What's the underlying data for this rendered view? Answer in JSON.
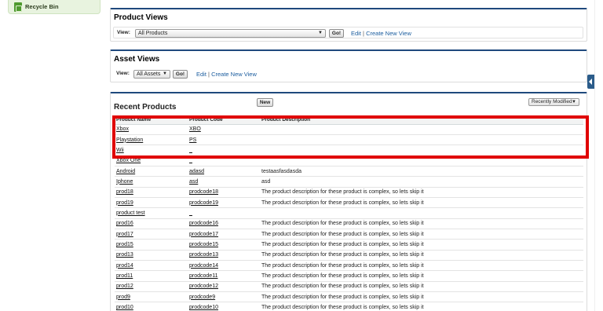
{
  "sidebar": {
    "recycle_bin": "Recycle Bin"
  },
  "product_views": {
    "title": "Product Views",
    "view_label": "View:",
    "selected": "All Products",
    "go": "Go!",
    "edit": "Edit",
    "create": "Create New View"
  },
  "asset_views": {
    "title": "Asset Views",
    "view_label": "View:",
    "selected": "All Assets",
    "go": "Go!",
    "edit": "Edit",
    "create": "Create New View"
  },
  "recent": {
    "title": "Recent Products",
    "new": "New",
    "sort": "Recently Modified",
    "columns": [
      "Product Name",
      "Product Code",
      "Product Description"
    ],
    "rows": [
      [
        "Xbox",
        "XBO",
        ""
      ],
      [
        "Playstation",
        "PS",
        ""
      ],
      [
        "Wii",
        "_",
        ""
      ],
      [
        "Xbox One",
        "_",
        ""
      ],
      [
        "Android",
        "adasd",
        "testaasfasdasda"
      ],
      [
        "Iphone",
        "asd",
        "asd"
      ],
      [
        "prod18",
        "prodcode18",
        "The product description for these product is complex, so lets skip it"
      ],
      [
        "prod19",
        "prodcode19",
        "The product description for these product is complex, so lets skip it"
      ],
      [
        "product test",
        "_",
        ""
      ],
      [
        "prod16",
        "prodcode16",
        "The product description for these product is complex, so lets skip it"
      ],
      [
        "prod17",
        "prodcode17",
        "The product description for these product is complex, so lets skip it"
      ],
      [
        "prod15",
        "prodcode15",
        "The product description for these product is complex, so lets skip it"
      ],
      [
        "prod13",
        "prodcode13",
        "The product description for these product is complex, so lets skip it"
      ],
      [
        "prod14",
        "prodcode14",
        "The product description for these product is complex, so lets skip it"
      ],
      [
        "prod11",
        "prodcode11",
        "The product description for these product is complex, so lets skip it"
      ],
      [
        "prod12",
        "prodcode12",
        "The product description for these product is complex, so lets skip it"
      ],
      [
        "prod9",
        "prodcode9",
        "The product description for these product is complex, so lets skip it"
      ],
      [
        "prod10",
        "prodcode10",
        "The product description for these product is complex, so lets skip it"
      ]
    ]
  },
  "colors": {
    "header_border": "#1f497d",
    "highlight": "#e00000",
    "link": "#1a5c9e"
  },
  "icons": {
    "recycle": "recycle-bin-icon",
    "collapse": "collapse-arrow-icon"
  }
}
